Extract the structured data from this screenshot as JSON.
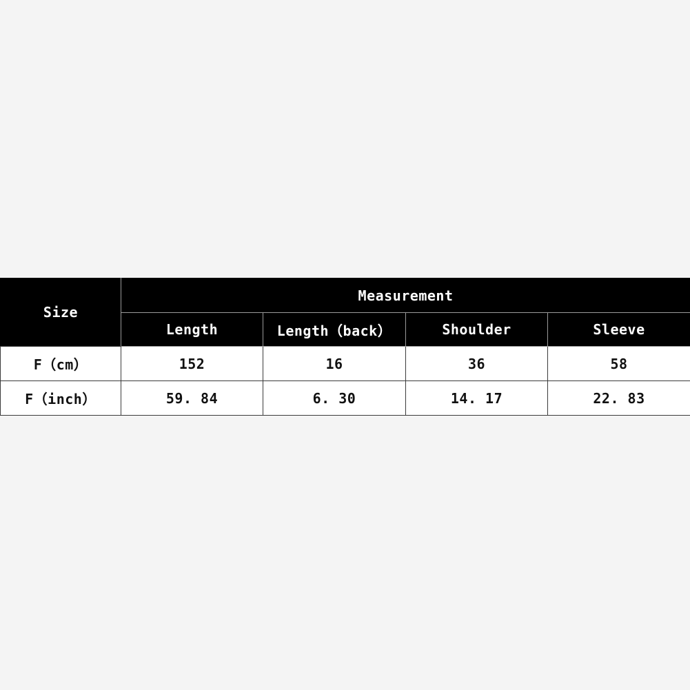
{
  "background_color": "#f4f4f4",
  "table": {
    "name": "size-chart",
    "header_bg": "#000000",
    "header_fg": "#ffffff",
    "cell_bg": "#ffffff",
    "cell_fg": "#111111",
    "border_color": "#3a3a3a",
    "size_column_header": "Size",
    "group_header": "Measurement",
    "measurement_columns": [
      "Length",
      "Length（back）",
      "Shoulder",
      "Sleeve"
    ],
    "rows": [
      {
        "label": "F（cm）",
        "values": [
          "152",
          "16",
          "36",
          "58"
        ]
      },
      {
        "label": "F（inch）",
        "values": [
          "59. 84",
          "6. 30",
          "14. 17",
          "22. 83"
        ]
      }
    ]
  }
}
